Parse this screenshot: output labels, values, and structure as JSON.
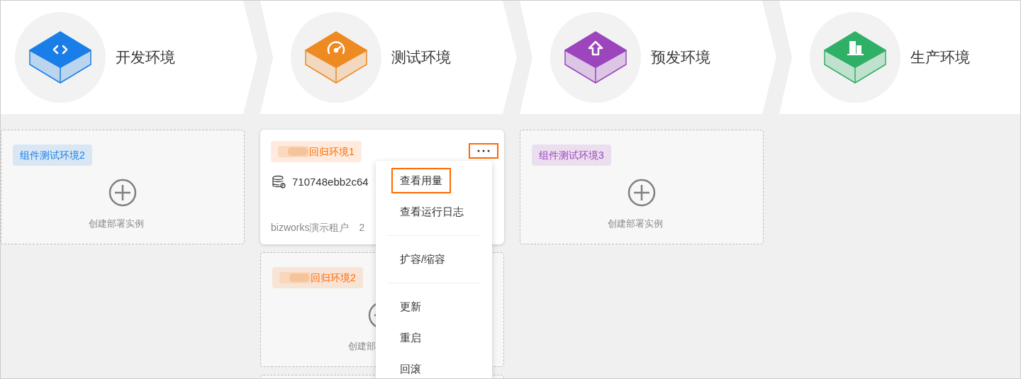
{
  "stages": [
    {
      "title": "开发环境",
      "color": "#1a7ee8",
      "kind": "code"
    },
    {
      "title": "测试环境",
      "color": "#ee8a22",
      "kind": "gauge"
    },
    {
      "title": "预发环境",
      "color": "#9c45bd",
      "kind": "upload"
    },
    {
      "title": "生产环境",
      "color": "#2fb066",
      "kind": "building"
    }
  ],
  "columns": [
    {
      "cards": [
        {
          "kind": "empty",
          "tag": {
            "text": "组件测试环境2",
            "color": "#1a7ee8",
            "redacted": false
          },
          "action": "创建部署实例"
        }
      ]
    },
    {
      "cards": [
        {
          "kind": "instance",
          "tag": {
            "text": "回归环境1",
            "color": "#ff6a00",
            "redacted": true
          },
          "more_highlighted": true,
          "id": "710748ebb2c64",
          "owner": "bizworks演示租户",
          "date": "2"
        },
        {
          "kind": "empty",
          "tag": {
            "text": "回归环境2",
            "color": "#ff6a00",
            "redacted": true
          },
          "action": "创建部"
        },
        {
          "kind": "cut"
        }
      ],
      "menu": {
        "items": [
          {
            "kind": "item",
            "label": "查看用量",
            "highlighted": true
          },
          {
            "kind": "item",
            "label": "查看运行日志",
            "highlighted": false
          },
          {
            "kind": "divider"
          },
          {
            "kind": "item",
            "label": "扩容/缩容",
            "highlighted": false
          },
          {
            "kind": "divider"
          },
          {
            "kind": "item",
            "label": "更新",
            "highlighted": false
          },
          {
            "kind": "item",
            "label": "重启",
            "highlighted": false
          },
          {
            "kind": "item",
            "label": "回滚",
            "highlighted": false
          }
        ]
      }
    },
    {
      "cards": [
        {
          "kind": "empty",
          "tag": {
            "text": "组件测试环境3",
            "color": "#9c45bd",
            "redacted": false
          },
          "action": "创建部署实例"
        }
      ]
    }
  ]
}
